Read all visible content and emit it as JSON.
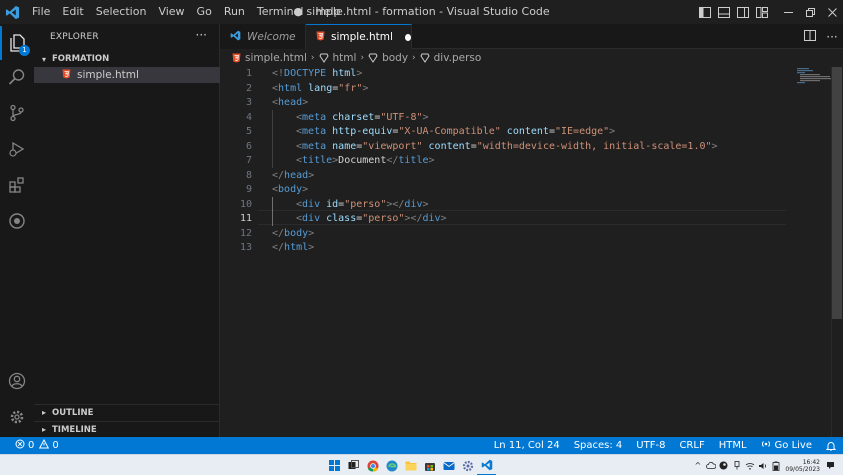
{
  "window": {
    "title": "● simple.html - formation - Visual Studio Code",
    "menu": [
      "File",
      "Edit",
      "Selection",
      "View",
      "Go",
      "Run",
      "Terminal",
      "Help"
    ],
    "controls": [
      "minimize-icon",
      "restore-icon",
      "close-icon"
    ],
    "layout_icons": [
      "toggle-primary-sidebar-icon",
      "toggle-panel-icon",
      "toggle-secondary-sidebar-icon",
      "customize-layout-icon"
    ]
  },
  "activity_bar": {
    "items": [
      "files-icon",
      "search-icon",
      "source-control-icon",
      "run-debug-icon",
      "extensions-icon",
      "remote-icon"
    ],
    "explorer_badge": "1",
    "bottom": [
      "accounts-icon",
      "manage-gear-icon"
    ]
  },
  "sidebar": {
    "title": "EXPLORER",
    "more": "···",
    "folder": "FORMATION",
    "files": [
      {
        "name": "simple.html",
        "icon": "html5-icon",
        "selected": true
      }
    ],
    "sections": [
      "OUTLINE",
      "TIMELINE"
    ]
  },
  "tabs": [
    {
      "label": "Welcome",
      "icon": "vscode-icon",
      "active": false
    },
    {
      "label": "simple.html",
      "icon": "html5-icon",
      "active": true,
      "dirty": true
    }
  ],
  "breadcrumb": [
    "simple.html",
    "html",
    "body",
    "div.perso"
  ],
  "editor": {
    "active_line": 11,
    "lines": [
      {
        "n": "1",
        "indent": 0,
        "tokens": [
          {
            "t": "br",
            "v": "<!"
          },
          {
            "t": "tag",
            "v": "DOCTYPE"
          },
          {
            "t": "txt",
            "v": " "
          },
          {
            "t": "attr",
            "v": "html"
          },
          {
            "t": "br",
            "v": ">"
          }
        ]
      },
      {
        "n": "2",
        "indent": 0,
        "tokens": [
          {
            "t": "br",
            "v": "<"
          },
          {
            "t": "tag",
            "v": "html"
          },
          {
            "t": "txt",
            "v": " "
          },
          {
            "t": "attr",
            "v": "lang"
          },
          {
            "t": "txt",
            "v": "="
          },
          {
            "t": "str",
            "v": "\"fr\""
          },
          {
            "t": "br",
            "v": ">"
          }
        ]
      },
      {
        "n": "3",
        "indent": 0,
        "tokens": [
          {
            "t": "br",
            "v": "<"
          },
          {
            "t": "tag",
            "v": "head"
          },
          {
            "t": "br",
            "v": ">"
          }
        ]
      },
      {
        "n": "4",
        "indent": 1,
        "tokens": [
          {
            "t": "br",
            "v": "<"
          },
          {
            "t": "tag",
            "v": "meta"
          },
          {
            "t": "txt",
            "v": " "
          },
          {
            "t": "attr",
            "v": "charset"
          },
          {
            "t": "txt",
            "v": "="
          },
          {
            "t": "str",
            "v": "\"UTF-8\""
          },
          {
            "t": "br",
            "v": ">"
          }
        ]
      },
      {
        "n": "5",
        "indent": 1,
        "tokens": [
          {
            "t": "br",
            "v": "<"
          },
          {
            "t": "tag",
            "v": "meta"
          },
          {
            "t": "txt",
            "v": " "
          },
          {
            "t": "attr",
            "v": "http-equiv"
          },
          {
            "t": "txt",
            "v": "="
          },
          {
            "t": "str",
            "v": "\"X-UA-Compatible\""
          },
          {
            "t": "txt",
            "v": " "
          },
          {
            "t": "attr",
            "v": "content"
          },
          {
            "t": "txt",
            "v": "="
          },
          {
            "t": "str",
            "v": "\"IE=edge\""
          },
          {
            "t": "br",
            "v": ">"
          }
        ]
      },
      {
        "n": "6",
        "indent": 1,
        "tokens": [
          {
            "t": "br",
            "v": "<"
          },
          {
            "t": "tag",
            "v": "meta"
          },
          {
            "t": "txt",
            "v": " "
          },
          {
            "t": "attr",
            "v": "name"
          },
          {
            "t": "txt",
            "v": "="
          },
          {
            "t": "str",
            "v": "\"viewport\""
          },
          {
            "t": "txt",
            "v": " "
          },
          {
            "t": "attr",
            "v": "content"
          },
          {
            "t": "txt",
            "v": "="
          },
          {
            "t": "str",
            "v": "\"width=device-width, initial-scale=1.0\""
          },
          {
            "t": "br",
            "v": ">"
          }
        ]
      },
      {
        "n": "7",
        "indent": 1,
        "tokens": [
          {
            "t": "br",
            "v": "<"
          },
          {
            "t": "tag",
            "v": "title"
          },
          {
            "t": "br",
            "v": ">"
          },
          {
            "t": "txt",
            "v": "Document"
          },
          {
            "t": "br",
            "v": "</"
          },
          {
            "t": "tag",
            "v": "title"
          },
          {
            "t": "br",
            "v": ">"
          }
        ]
      },
      {
        "n": "8",
        "indent": 0,
        "tokens": [
          {
            "t": "br",
            "v": "</"
          },
          {
            "t": "tag",
            "v": "head"
          },
          {
            "t": "br",
            "v": ">"
          }
        ]
      },
      {
        "n": "9",
        "indent": 0,
        "tokens": [
          {
            "t": "br",
            "v": "<"
          },
          {
            "t": "tag",
            "v": "body"
          },
          {
            "t": "br",
            "v": ">"
          }
        ]
      },
      {
        "n": "10",
        "indent": 1,
        "tokens": [
          {
            "t": "br",
            "v": "<"
          },
          {
            "t": "tag",
            "v": "div"
          },
          {
            "t": "txt",
            "v": " "
          },
          {
            "t": "attr",
            "v": "id"
          },
          {
            "t": "txt",
            "v": "="
          },
          {
            "t": "str",
            "v": "\"perso\""
          },
          {
            "t": "br",
            "v": "></"
          },
          {
            "t": "tag",
            "v": "div"
          },
          {
            "t": "br",
            "v": ">"
          }
        ]
      },
      {
        "n": "11",
        "indent": 1,
        "tokens": [
          {
            "t": "br",
            "v": "<"
          },
          {
            "t": "tag",
            "v": "div"
          },
          {
            "t": "txt",
            "v": " "
          },
          {
            "t": "attr",
            "v": "class"
          },
          {
            "t": "txt",
            "v": "="
          },
          {
            "t": "str",
            "v": "\"perso\""
          },
          {
            "t": "br",
            "v": "></"
          },
          {
            "t": "tag",
            "v": "div"
          },
          {
            "t": "br",
            "v": ">"
          }
        ]
      },
      {
        "n": "12",
        "indent": 0,
        "tokens": [
          {
            "t": "br",
            "v": "</"
          },
          {
            "t": "tag",
            "v": "body"
          },
          {
            "t": "br",
            "v": ">"
          }
        ]
      },
      {
        "n": "13",
        "indent": 0,
        "tokens": [
          {
            "t": "br",
            "v": "</"
          },
          {
            "t": "tag",
            "v": "html"
          },
          {
            "t": "br",
            "v": ">"
          }
        ]
      }
    ]
  },
  "status_bar": {
    "errors": "0",
    "warnings": "0",
    "position": "Ln 11, Col 24",
    "spaces": "Spaces: 4",
    "encoding": "UTF-8",
    "eol": "CRLF",
    "language": "HTML",
    "go_live": "Go Live"
  },
  "taskbar": {
    "apps": [
      "windows-start-icon",
      "task-view-icon",
      "chrome-icon",
      "edge-icon",
      "file-explorer-icon",
      "store-icon",
      "mail-icon",
      "settings-icon",
      "vscode-icon"
    ],
    "clock_time": "16:42",
    "clock_date": "09/05/2023"
  },
  "colors": {
    "accent": "#0078d4",
    "tag": "#569cd6",
    "attribute": "#9cdcfe",
    "string": "#ce9178",
    "html_icon": "#e44d26"
  }
}
